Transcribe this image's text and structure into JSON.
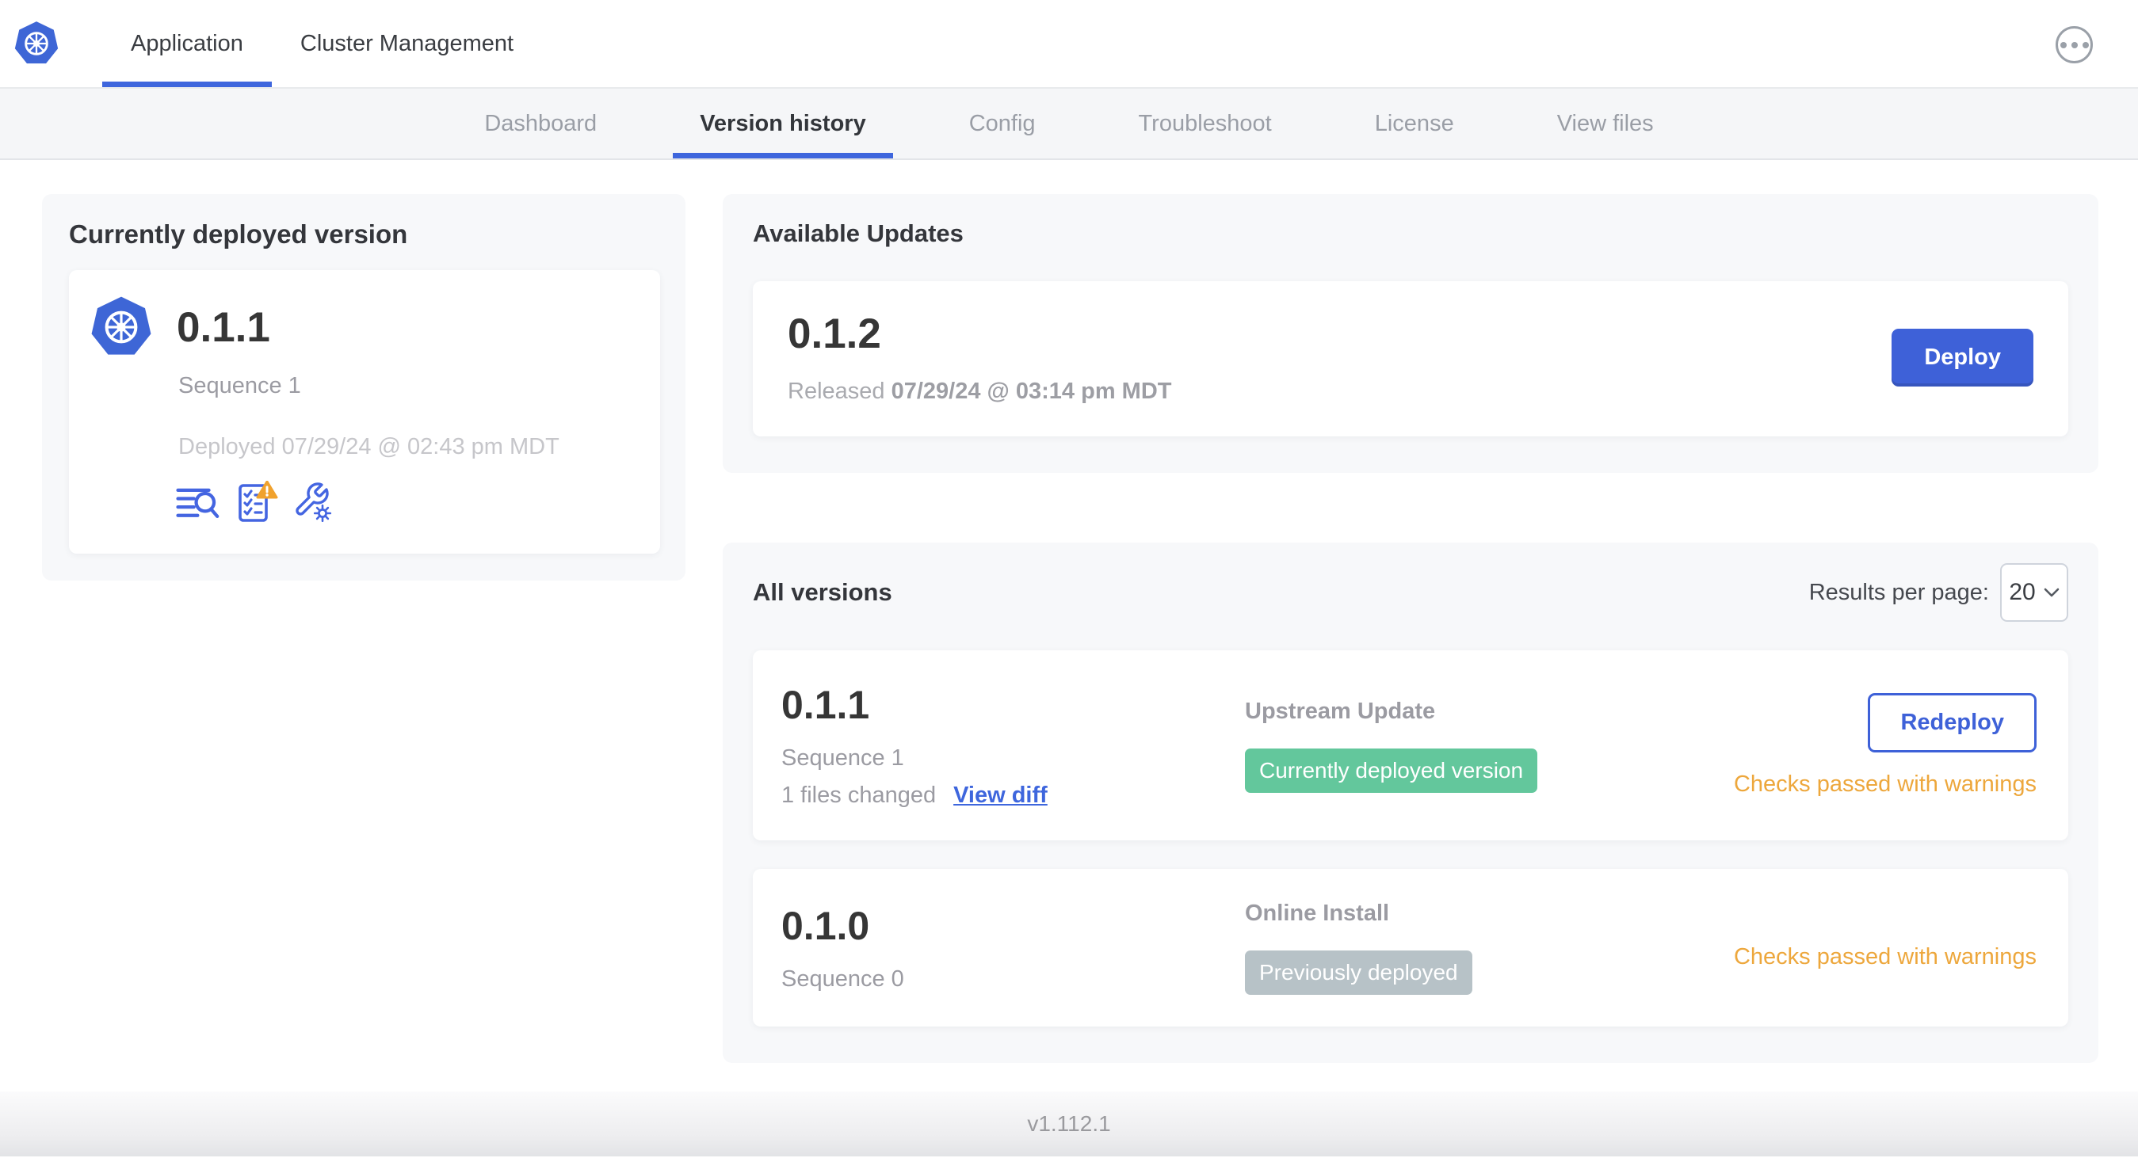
{
  "header": {
    "tabs": [
      {
        "label": "Application",
        "active": true
      },
      {
        "label": "Cluster Management",
        "active": false
      }
    ],
    "more_menu_icon": "ellipsis-icon",
    "logo_icon": "kubernetes-logo"
  },
  "subnav": {
    "items": [
      {
        "label": "Dashboard",
        "active": false
      },
      {
        "label": "Version history",
        "active": true
      },
      {
        "label": "Config",
        "active": false
      },
      {
        "label": "Troubleshoot",
        "active": false
      },
      {
        "label": "License",
        "active": false
      },
      {
        "label": "View files",
        "active": false
      }
    ]
  },
  "current_version_card": {
    "title": "Currently deployed version",
    "version": "0.1.1",
    "sequence": "Sequence 1",
    "deployed": "Deployed 07/29/24 @ 02:43 pm MDT",
    "icons": [
      "release-notes-icon",
      "preflight-checks-warning-icon",
      "config-wrench-icon"
    ]
  },
  "available_updates": {
    "title": "Available Updates",
    "version": "0.1.2",
    "released_label": "Released",
    "released_date": "07/29/24 @ 03:14 pm MDT",
    "deploy_label": "Deploy"
  },
  "all_versions": {
    "title": "All versions",
    "results_per_page_label": "Results per page:",
    "results_per_page_value": "20",
    "rows": [
      {
        "version": "0.1.1",
        "sequence": "Sequence 1",
        "files_changed": "1 files changed",
        "view_diff_label": "View diff",
        "source": "Upstream Update",
        "badge": "Currently deployed version",
        "badge_color": "#63c79c",
        "status": "Checks passed with warnings",
        "action_label": "Redeploy",
        "icons": [
          "preflight-checks-warning-icon",
          "config-wrench-icon",
          "release-notes-icon"
        ]
      },
      {
        "version": "0.1.0",
        "sequence": "Sequence 0",
        "source": "Online Install",
        "badge": "Previously deployed",
        "badge_color": "#b7c2c7",
        "status": "Checks passed with warnings",
        "icons": [
          "preflight-checks-warning-icon",
          "config-wrench-icon",
          "release-notes-icon"
        ]
      }
    ]
  },
  "footer": {
    "version": "v1.112.1"
  },
  "colors": {
    "accent_blue": "#3e61d8",
    "nav_underline_blue": "#3e66dd",
    "icon_blue": "#4465e1",
    "badge_green": "#63c79c",
    "badge_gray": "#b7c2c7",
    "warning_orange": "#eda73c",
    "warning_triangle": "#f0a22e"
  }
}
